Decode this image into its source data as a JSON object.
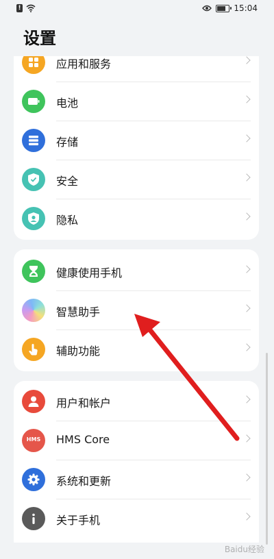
{
  "status_bar": {
    "time": "15:04",
    "icons": [
      "alert-icon",
      "wifi-icon",
      "eye-icon",
      "battery-icon"
    ]
  },
  "header": {
    "title": "设置"
  },
  "groups": [
    {
      "items": [
        {
          "label": "应用和服务",
          "icon": "apps-icon",
          "color": "#f5a623"
        },
        {
          "label": "电池",
          "icon": "battery-icon",
          "color": "#3fc45c"
        },
        {
          "label": "存储",
          "icon": "storage-icon",
          "color": "#2f6fdb"
        },
        {
          "label": "安全",
          "icon": "shield-icon",
          "color": "#46c2b3"
        },
        {
          "label": "隐私",
          "icon": "privacy-icon",
          "color": "#46c2b3"
        }
      ]
    },
    {
      "items": [
        {
          "label": "健康使用手机",
          "icon": "hourglass-icon",
          "color": "#3fc45c"
        },
        {
          "label": "智慧助手",
          "icon": "assistant-icon",
          "color": "#c99bf0"
        },
        {
          "label": "辅助功能",
          "icon": "accessibility-icon",
          "color": "#f5a623"
        }
      ]
    },
    {
      "items": [
        {
          "label": "用户和帐户",
          "icon": "user-icon",
          "color": "#e84a3b"
        },
        {
          "label": "HMS Core",
          "icon": "hms-icon",
          "color": "#e5564a",
          "icon_text": "HMS"
        },
        {
          "label": "系统和更新",
          "icon": "gear-icon",
          "color": "#2f6fdb"
        },
        {
          "label": "关于手机",
          "icon": "info-icon",
          "color": "#5a5a5a"
        }
      ]
    }
  ],
  "annotation": {
    "arrow_color": "#e01e1e"
  },
  "watermark": "Baidu经验"
}
